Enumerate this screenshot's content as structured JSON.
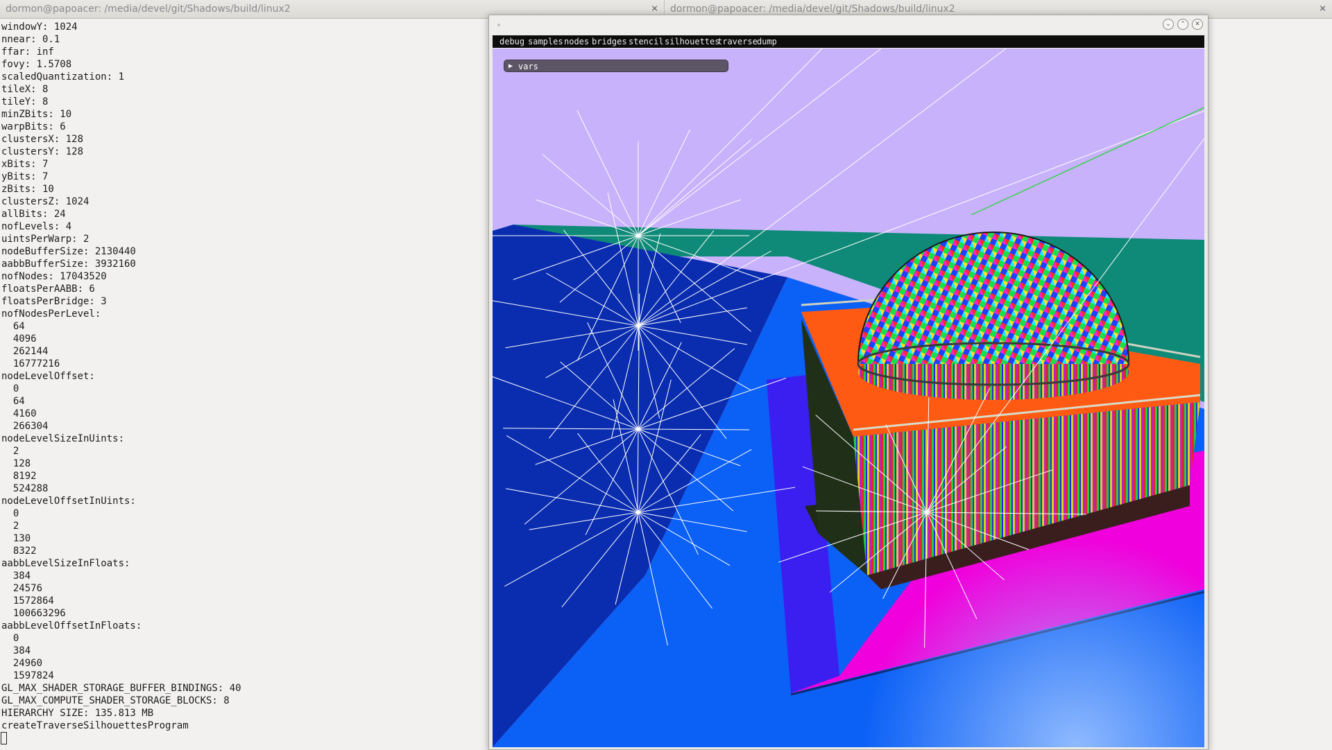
{
  "tabs": [
    {
      "title": "dormon@papoacer: /media/devel/git/Shadows/build/linux2",
      "close": "⨯"
    },
    {
      "title": "dormon@papoacer: /media/devel/git/Shadows/build/linux2",
      "close": "⨯"
    }
  ],
  "terminal": {
    "lines": [
      "windowY: 1024",
      "nnear: 0.1",
      "ffar: inf",
      "fovy: 1.5708",
      "scaledQuantization: 1",
      "tileX: 8",
      "tileY: 8",
      "minZBits: 10",
      "warpBits: 6",
      "clustersX: 128",
      "clustersY: 128",
      "xBits: 7",
      "yBits: 7",
      "zBits: 10",
      "clustersZ: 1024",
      "allBits: 24",
      "nofLevels: 4",
      "uintsPerWarp: 2",
      "nodeBufferSize: 2130440",
      "aabbBufferSize: 3932160",
      "nofNodes: 17043520",
      "floatsPerAABB: 6",
      "floatsPerBridge: 3",
      "nofNodesPerLevel:",
      "  64",
      "  4096",
      "  262144",
      "  16777216",
      "nodeLevelOffset:",
      "  0",
      "  64",
      "  4160",
      "  266304",
      "nodeLevelSizeInUints:",
      "  2",
      "  128",
      "  8192",
      "  524288",
      "nodeLevelOffsetInUints:",
      "  0",
      "  2",
      "  130",
      "  8322",
      "aabbLevelSizeInFloats:",
      "  384",
      "  24576",
      "  1572864",
      "  100663296",
      "aabbLevelOffsetInFloats:",
      "  0",
      "  384",
      "  24960",
      "  1597824",
      "GL_MAX_SHADER_STORAGE_BUFFER_BINDINGS: 40",
      "GL_MAX_COMPUTE_SHADER_STORAGE_BLOCKS: 8",
      "HIERARCHY SIZE: 135.813 MB",
      "createTraverseSilhouettesProgram"
    ]
  },
  "app": {
    "window_controls": [
      "⌄",
      "⌃",
      "✕"
    ],
    "menu": [
      "debug",
      "samples",
      "nodes",
      "bridges",
      "stencil",
      "silhouettes",
      "traverse",
      "dump"
    ],
    "vars_panel": {
      "label": "vars",
      "arrow": "▶"
    }
  },
  "colors": {
    "sky": "#c8b2fb",
    "ground_blue": "#0b60f6",
    "ground_dark_blue": "#0a2db0",
    "ground_teal": "#0f8a78",
    "shadow_indigo": "#3b1ef0",
    "plane_magenta": "#f000dc",
    "light_lines": "#ffffff",
    "menubar": "#0d0d0d",
    "vars_panel": "#5b5566"
  }
}
